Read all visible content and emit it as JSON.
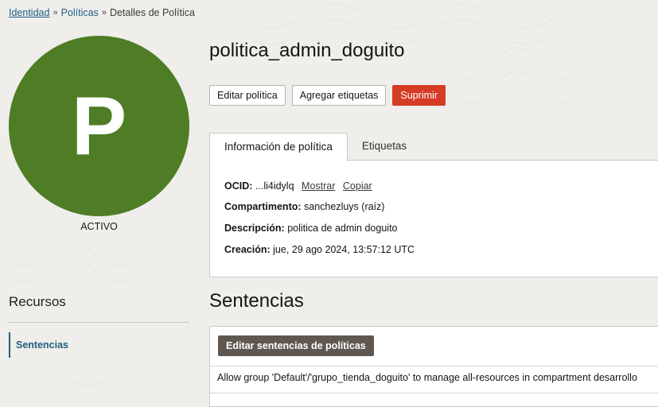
{
  "breadcrumb": {
    "items": [
      "Identidad",
      "Políticas"
    ],
    "current": "Detalles de Política"
  },
  "avatar": {
    "letter": "P",
    "color": "#4e7d25"
  },
  "status": "ACTIVO",
  "policy": {
    "name": "politica_admin_doguito"
  },
  "actions": {
    "edit": "Editar política",
    "tags": "Agregar etiquetas",
    "delete": "Suprimir"
  },
  "tabs": [
    "Información de política",
    "Etiquetas"
  ],
  "info": {
    "ocid_label": "OCID:",
    "ocid_value": "...li4idylq",
    "show": "Mostrar",
    "copy": "Copiar",
    "compartment_label": "Compartimento:",
    "compartment_value": "sanchezluys (raíz)",
    "description_label": "Descripción:",
    "description_value": "politica de admin doguito",
    "created_label": "Creación:",
    "created_value": "jue, 29 ago 2024, 13:57:12 UTC"
  },
  "resources": {
    "title": "Recursos",
    "items": [
      "Sentencias"
    ]
  },
  "statements": {
    "title": "Sentencias",
    "edit_button": "Editar sentencias de políticas",
    "items": [
      "Allow group 'Default'/'grupo_tienda_doguito' to manage all-resources in compartment desarrollo"
    ]
  }
}
